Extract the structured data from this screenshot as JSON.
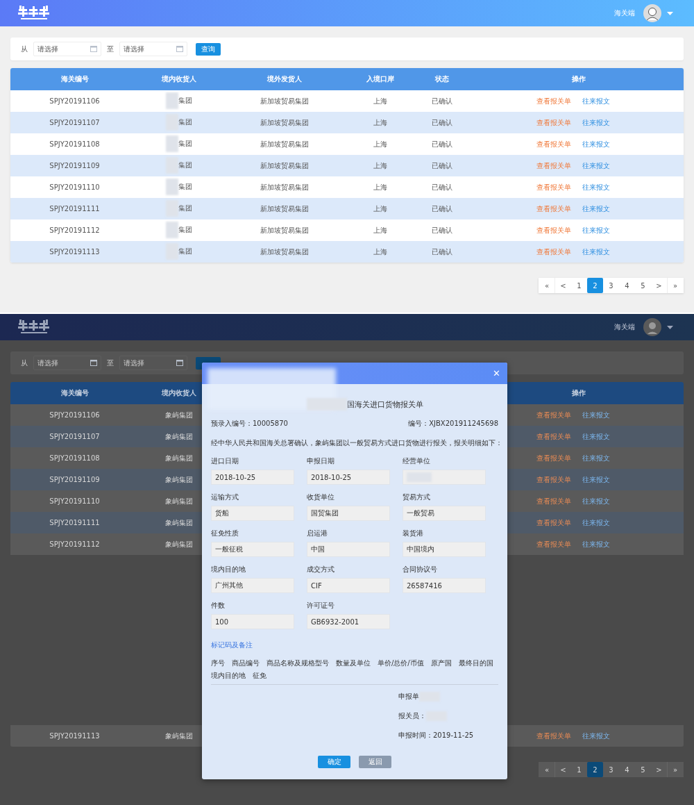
{
  "screens": [
    {
      "kind": "list",
      "header": {
        "user_name": "海关端"
      },
      "filter": {
        "from_label": "从",
        "from_placeholder": "请选择",
        "to_label": "至",
        "to_placeholder": "请选择",
        "query_button": "查询"
      },
      "table": {
        "header": {
          "id": "海关编号",
          "receiver": "境内收货人",
          "shipper": "境外发货人",
          "port": "入境口岸",
          "status": "状态",
          "actions": "操作"
        },
        "rows": [
          {
            "id": "SPJY20191106",
            "receiver": "集团",
            "receiver_blurred": true,
            "shipper": "新加坡贸易集团",
            "port": "上海",
            "status": "已确认",
            "view_link": "查看报关单",
            "messages_link": "往来报文"
          },
          {
            "id": "SPJY20191107",
            "receiver": "集团",
            "receiver_blurred": true,
            "shipper": "新加坡贸易集团",
            "port": "上海",
            "status": "已确认",
            "view_link": "查看报关单",
            "messages_link": "往来报文"
          },
          {
            "id": "SPJY20191108",
            "receiver": "集团",
            "receiver_blurred": true,
            "shipper": "新加坡贸易集团",
            "port": "上海",
            "status": "已确认",
            "view_link": "查看报关单",
            "messages_link": "往来报文"
          },
          {
            "id": "SPJY20191109",
            "receiver": "集团",
            "receiver_blurred": true,
            "shipper": "新加坡贸易集团",
            "port": "上海",
            "status": "已确认",
            "view_link": "查看报关单",
            "messages_link": "往来报文"
          },
          {
            "id": "SPJY20191110",
            "receiver": "集团",
            "receiver_blurred": true,
            "shipper": "新加坡贸易集团",
            "port": "上海",
            "status": "已确认",
            "view_link": "查看报关单",
            "messages_link": "往来报文"
          },
          {
            "id": "SPJY20191111",
            "receiver": "集团",
            "receiver_blurred": true,
            "shipper": "新加坡贸易集团",
            "port": "上海",
            "status": "已确认",
            "view_link": "查看报关单",
            "messages_link": "往来报文"
          },
          {
            "id": "SPJY20191112",
            "receiver": "集团",
            "receiver_blurred": true,
            "shipper": "新加坡贸易集团",
            "port": "上海",
            "status": "已确认",
            "view_link": "查看报关单",
            "messages_link": "往来报文"
          },
          {
            "id": "SPJY20191113",
            "receiver": "集团",
            "receiver_blurred": true,
            "shipper": "新加坡贸易集团",
            "port": "上海",
            "status": "已确认",
            "view_link": "查看报关单",
            "messages_link": "往来报文"
          }
        ]
      },
      "pagination": {
        "first": "«",
        "prev": "<",
        "pages": [
          {
            "label": "1",
            "selected": false
          },
          {
            "label": "2",
            "selected": true
          },
          {
            "label": "3",
            "selected": false
          },
          {
            "label": "4",
            "selected": false
          },
          {
            "label": "5",
            "selected": false
          }
        ],
        "next": ">",
        "last": "»"
      }
    },
    {
      "kind": "list_with_modal",
      "header": {
        "user_name": "海关端"
      },
      "filter": {
        "from_label": "从",
        "from_placeholder": "请选择",
        "to_label": "至",
        "to_placeholder": "请选择"
      },
      "table": {
        "header": {
          "id": "海关编号",
          "receiver": "境内收货人",
          "actions": "操作"
        },
        "rows": [
          {
            "id": "SPJY20191106",
            "receiver": "象屿集团",
            "view_link": "查看报关单",
            "messages_link": "往来报文"
          },
          {
            "id": "SPJY20191107",
            "receiver": "象屿集团",
            "view_link": "查看报关单",
            "messages_link": "往来报文"
          },
          {
            "id": "SPJY20191108",
            "receiver": "象屿集团",
            "view_link": "查看报关单",
            "messages_link": "往来报文"
          },
          {
            "id": "SPJY20191109",
            "receiver": "象屿集团",
            "view_link": "查看报关单",
            "messages_link": "往来报文"
          },
          {
            "id": "SPJY20191110",
            "receiver": "象屿集团",
            "view_link": "查看报关单",
            "messages_link": "往来报文"
          },
          {
            "id": "SPJY20191111",
            "receiver": "象屿集团",
            "view_link": "查看报关单",
            "messages_link": "往来报文"
          },
          {
            "id": "SPJY20191112",
            "receiver": "象屿集团",
            "view_link": "查看报关单",
            "messages_link": "往来报文"
          }
        ],
        "rows_below_gap": [
          {
            "id": "SPJY20191113",
            "receiver": "象屿集团",
            "view_link": "查看报关单",
            "messages_link": "往来报文"
          }
        ]
      },
      "pagination": {
        "first": "«",
        "prev": "<",
        "pages": [
          {
            "label": "1",
            "selected": false
          },
          {
            "label": "2",
            "selected": true
          },
          {
            "label": "3",
            "selected": false
          },
          {
            "label": "4",
            "selected": false
          },
          {
            "label": "5",
            "selected": false
          }
        ],
        "next": ">",
        "last": "»"
      },
      "modal": {
        "close": "✕",
        "header_blurred": true,
        "title": "国海关进口货物报关单",
        "title_blurred": true,
        "pre_entry_no": "预录入编号：10005870",
        "number": "编号：XJBX201911245698",
        "intro": "经中华人民共和国海关总署确认，象屿集团以一般贸易方式进口货物进行报关，报关明细如下：",
        "fields": [
          {
            "label": "进口日期",
            "value": "2018-10-25"
          },
          {
            "label": "申报日期",
            "value": "2018-10-25"
          },
          {
            "label": "经营单位",
            "blurred": true
          },
          {
            "label": "运输方式",
            "value": "货船"
          },
          {
            "label": "收货单位",
            "value": "国贸集团"
          },
          {
            "label": "贸易方式",
            "value": "一般贸易"
          },
          {
            "label": "征免性质",
            "value": "一般征税"
          },
          {
            "label": "启运港",
            "value": "中国"
          },
          {
            "label": "装货港",
            "value": "中国境内"
          },
          {
            "label": "境内目的地",
            "value": "广州其他"
          },
          {
            "label": "成交方式",
            "value": "CIF"
          },
          {
            "label": "合同协议号",
            "value": "26587416"
          },
          {
            "label": "件数",
            "value": "100"
          },
          {
            "label": "许可证号",
            "value": "GB6932-2001"
          }
        ],
        "marks_link": "标记码及备注",
        "goods_columns": [
          "序号",
          "商品编号",
          "商品名称及规格型号",
          "数量及单位",
          "单价/总价/币值",
          "原产国",
          "最终目的国",
          "境内目的地",
          "征免"
        ],
        "signatures": [
          {
            "label": "申报单",
            "blurred": true
          },
          {
            "label": "报关员：",
            "blurred": true
          },
          {
            "label": "申报时间：2019-11-25"
          }
        ],
        "confirm_button": "确定",
        "back_button": "返回"
      }
    }
  ]
}
